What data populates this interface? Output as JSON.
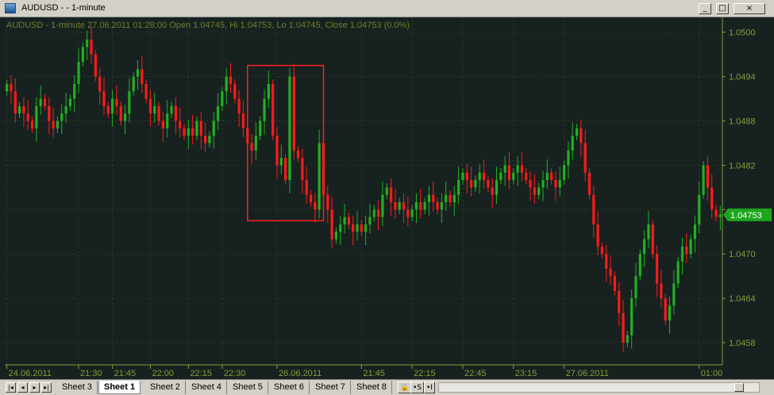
{
  "window": {
    "title": "AUDUSD - - 1-minute",
    "minimize_glyph": "_",
    "maximize_glyph": "□",
    "close_glyph": "×"
  },
  "legend": {
    "text": "AUDUSD - 1-minute 27.06.2011 01:28:00 Open 1.04745, Hi 1.04753, Lo 1.04745, Close 1.04753 (0.0%)"
  },
  "colors": {
    "background": "#172220",
    "up_candle": "#22b022",
    "down_candle": "#ff1a1a",
    "grid": "#3d4a30",
    "axis_text": "#8a9a3a",
    "price_tag": "#1ea51e",
    "highlight_box": "#ff2020"
  },
  "tabs": {
    "items": [
      "Sheet 3",
      "Sheet 1",
      "Sheet 2",
      "Sheet 4",
      "Sheet 5",
      "Sheet 6",
      "Sheet 7",
      "Sheet 8"
    ],
    "active": "Sheet 1",
    "nav_first": "|◂",
    "nav_prev": "◂",
    "nav_next": "▸",
    "nav_last": "▸|",
    "lock_glyph": "🔒",
    "btn_s": "•S",
    "btn_i": "•I"
  },
  "chart_data": {
    "type": "candlestick",
    "symbol": "AUDUSD",
    "timeframe": "1-minute",
    "y_ticks": [
      1.0458,
      1.0464,
      1.047,
      1.0476,
      1.0482,
      1.0488,
      1.0494,
      1.05
    ],
    "y_tick_labels": [
      "1.0458",
      "1.0464",
      "1.0470",
      "",
      "1.0482",
      "1.0488",
      "1.0494",
      "1.0500"
    ],
    "ylim": [
      1.0455,
      1.0502
    ],
    "x_labels": [
      "24.06.2011",
      "21:30",
      "21:45",
      "22:00",
      "22:15",
      "22:30",
      "26.06.2011",
      "21:45",
      "22:15",
      "22:45",
      "23:15",
      "27.06.2011",
      "01:00"
    ],
    "x_label_index": [
      0,
      17,
      25,
      34,
      43,
      51,
      64,
      84,
      96,
      108,
      120,
      132,
      164
    ],
    "current_price": "1.04753",
    "current_value": 1.04753,
    "highlight": {
      "from_index": 58,
      "to_index": 74
    },
    "closes": [
      1.0493,
      1.0492,
      1.0489,
      1.049,
      1.0489,
      1.0488,
      1.0487,
      1.049,
      1.0491,
      1.049,
      1.0488,
      1.0487,
      1.0488,
      1.0489,
      1.049,
      1.0491,
      1.0493,
      1.0496,
      1.0498,
      1.0499,
      1.0497,
      1.0494,
      1.0492,
      1.049,
      1.0489,
      1.0491,
      1.049,
      1.0488,
      1.0489,
      1.0492,
      1.0494,
      1.0495,
      1.0493,
      1.0491,
      1.0489,
      1.049,
      1.0488,
      1.0487,
      1.0489,
      1.049,
      1.0488,
      1.0487,
      1.0486,
      1.0487,
      1.0486,
      1.0488,
      1.0486,
      1.0485,
      1.0486,
      1.0488,
      1.049,
      1.0492,
      1.0494,
      1.0493,
      1.0491,
      1.0489,
      1.0487,
      1.0485,
      1.0484,
      1.0486,
      1.0488,
      1.0491,
      1.0493,
      1.0486,
      1.0482,
      1.0483,
      1.048,
      1.0494,
      1.0484,
      1.0483,
      1.048,
      1.0478,
      1.0477,
      1.0476,
      1.0485,
      1.0478,
      1.0476,
      1.0472,
      1.0473,
      1.0474,
      1.0475,
      1.0474,
      1.0473,
      1.0474,
      1.0473,
      1.0474,
      1.0475,
      1.0476,
      1.0475,
      1.0478,
      1.0479,
      1.0477,
      1.0476,
      1.0477,
      1.0476,
      1.0475,
      1.0476,
      1.0477,
      1.0476,
      1.0477,
      1.0478,
      1.0477,
      1.0476,
      1.0477,
      1.0478,
      1.0477,
      1.0478,
      1.048,
      1.0481,
      1.048,
      1.0479,
      1.048,
      1.0481,
      1.048,
      1.0479,
      1.0478,
      1.048,
      1.0481,
      1.0482,
      1.048,
      1.0481,
      1.0482,
      1.0481,
      1.048,
      1.0479,
      1.0478,
      1.0479,
      1.048,
      1.0481,
      1.048,
      1.0479,
      1.048,
      1.0482,
      1.0484,
      1.0486,
      1.0487,
      1.0485,
      1.0481,
      1.0478,
      1.0474,
      1.0471,
      1.047,
      1.0468,
      1.0467,
      1.0465,
      1.0462,
      1.0458,
      1.0459,
      1.0464,
      1.0467,
      1.047,
      1.0472,
      1.0474,
      1.047,
      1.0466,
      1.0464,
      1.0461,
      1.0463,
      1.0466,
      1.0469,
      1.0471,
      1.047,
      1.0472,
      1.0474,
      1.0478,
      1.0482,
      1.0479,
      1.0476,
      1.0475,
      1.04753
    ]
  }
}
